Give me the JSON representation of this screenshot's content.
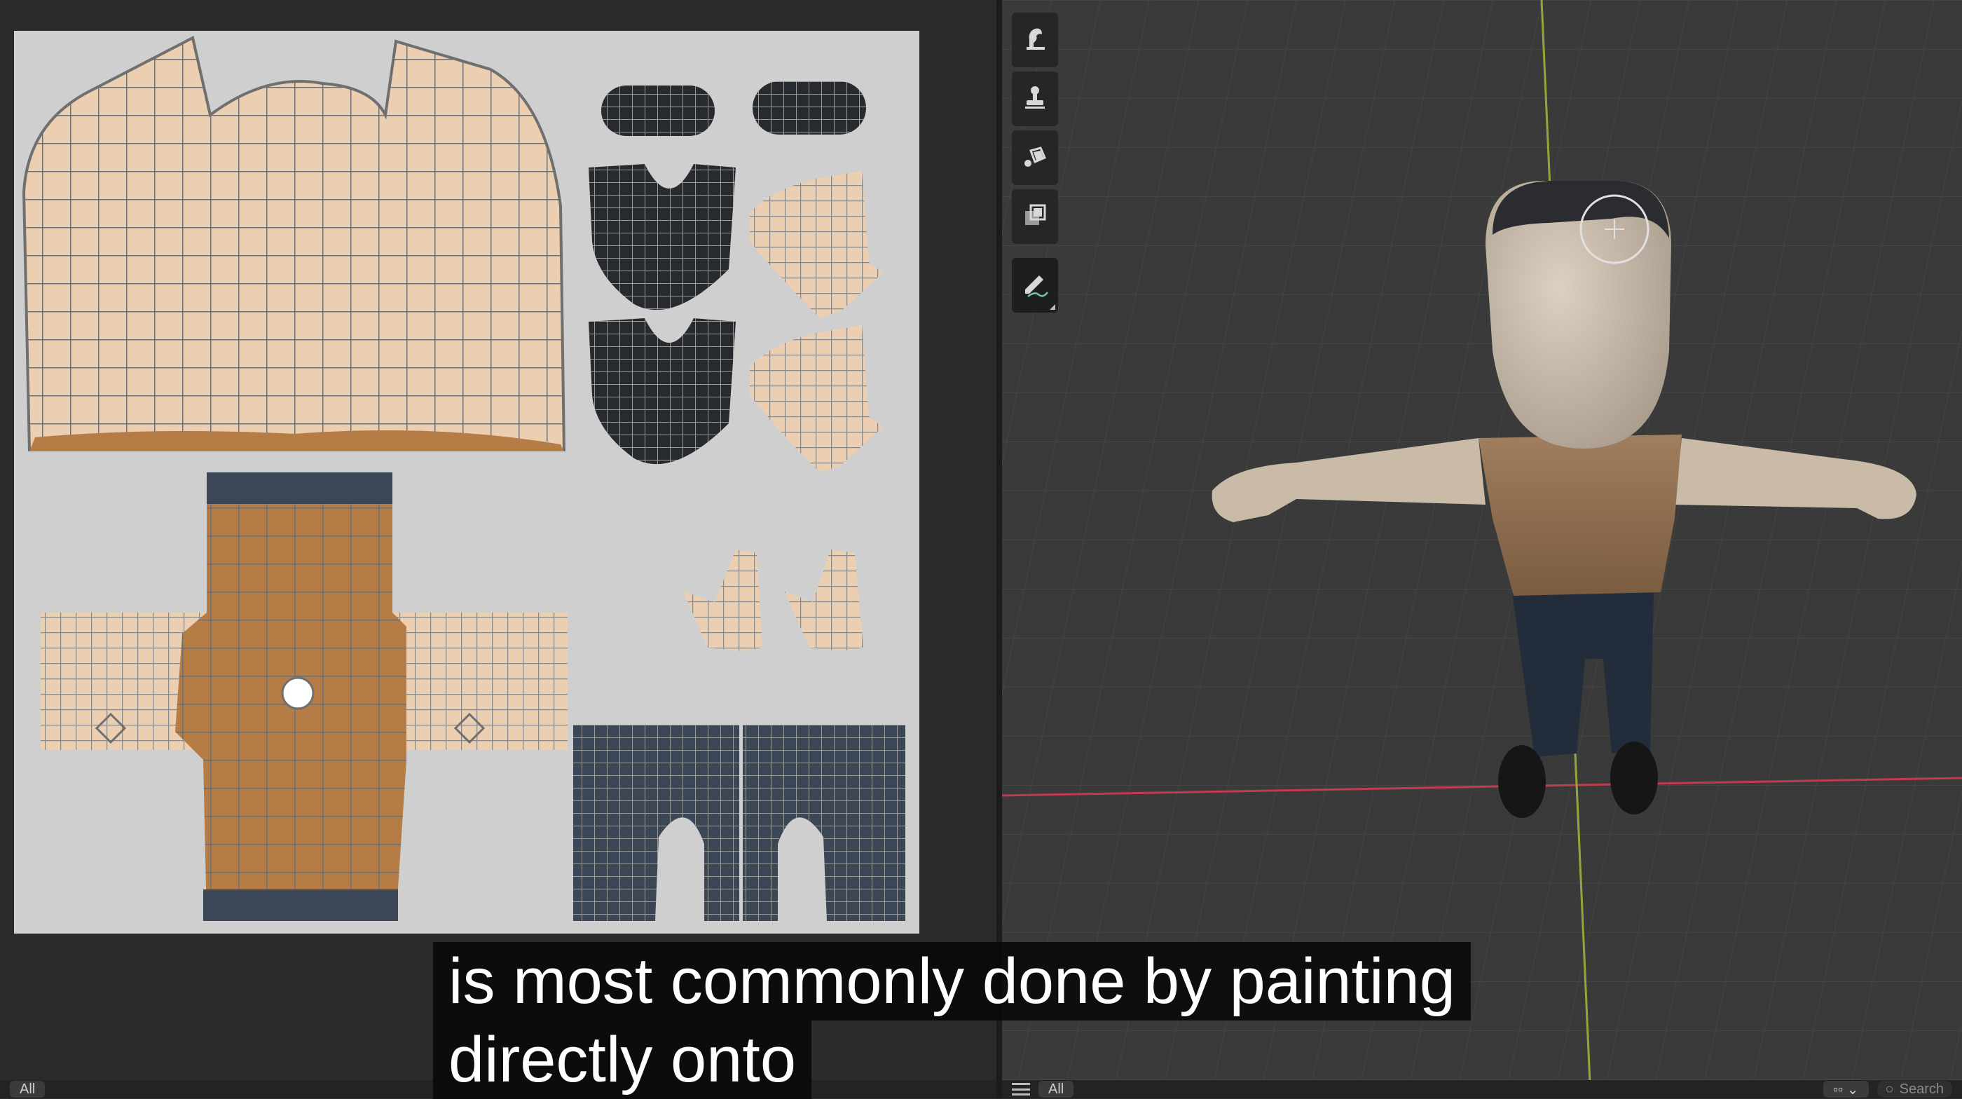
{
  "subtitle": {
    "line1": "is most commonly done by painting",
    "line2": "directly onto"
  },
  "uv_editor": {
    "footer_mode": "All"
  },
  "viewport": {
    "footer_mode": "All",
    "search_placeholder": "Search"
  },
  "toolbar": {
    "items": [
      {
        "icon": "smear-brush-icon"
      },
      {
        "icon": "clone-stamp-icon"
      },
      {
        "icon": "fill-bucket-icon"
      },
      {
        "icon": "mask-icon"
      },
      {
        "icon": "draw-brush-icon",
        "active": true
      }
    ]
  },
  "colors": {
    "skin": "#ecceb0",
    "shirt": "#b57c46",
    "pants": "#3b4757",
    "hair": "#272a2e",
    "uv_background": "#cfcfcf",
    "viewport_background": "#3a3a3a",
    "x_axis": "#c23a52",
    "y_axis": "#8fa83a"
  }
}
